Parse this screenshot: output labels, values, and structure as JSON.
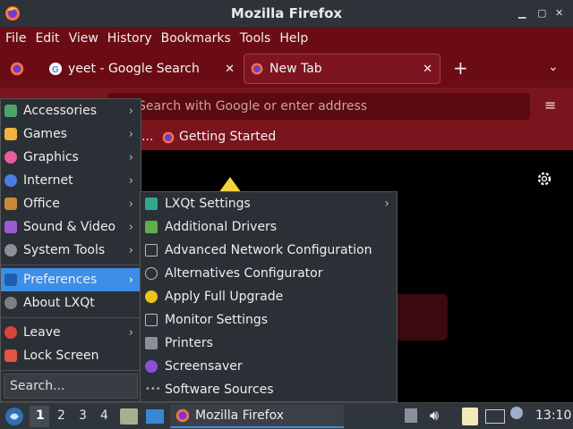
{
  "window": {
    "title": "Mozilla Firefox"
  },
  "menubar": {
    "items": [
      "File",
      "Edit",
      "View",
      "History",
      "Bookmarks",
      "Tools",
      "Help"
    ]
  },
  "tabs": [
    {
      "label": "yeet - Google Search"
    },
    {
      "label": "New Tab"
    }
  ],
  "urlbar": {
    "placeholder": "Search with Google or enter address"
  },
  "bookmarks": {
    "ellipsis": "...",
    "item": "Getting Started"
  },
  "appmenu": {
    "items": [
      "Accessories",
      "Games",
      "Graphics",
      "Internet",
      "Office",
      "Sound & Video",
      "System Tools",
      "Preferences",
      "About LXQt",
      "Leave",
      "Lock Screen"
    ],
    "search_placeholder": "Search..."
  },
  "submenu": {
    "items": [
      "LXQt Settings",
      "Additional Drivers",
      "Advanced Network Configuration",
      "Alternatives Configurator",
      "Apply Full Upgrade",
      "Monitor Settings",
      "Printers",
      "Screensaver",
      "Software Sources"
    ]
  },
  "taskbar": {
    "desktops": [
      "1",
      "2",
      "3",
      "4"
    ],
    "task_label": "Mozilla Firefox",
    "clock": "13:10"
  },
  "colors": {
    "accent": "#3d8ee6",
    "firefox_theme": "#6b0c14"
  }
}
